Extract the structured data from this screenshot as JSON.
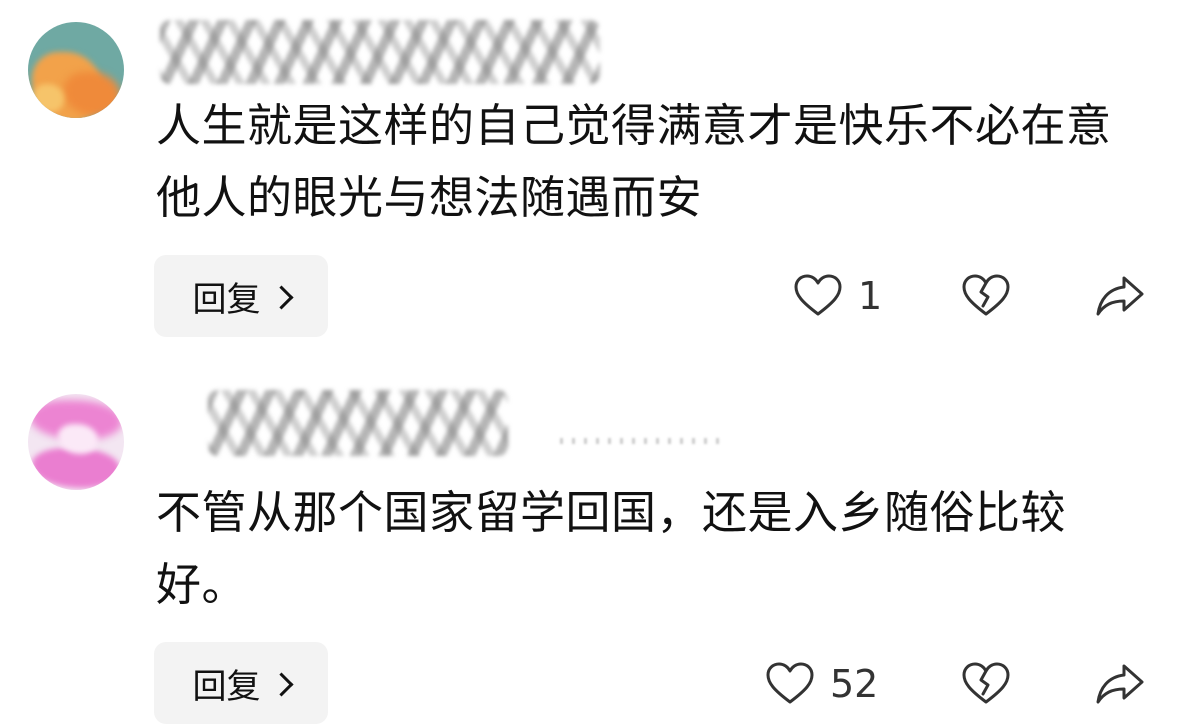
{
  "comments": [
    {
      "text": "人生就是这样的自己觉得满意才是快乐不必在意他人的眼光与想法随遇而安",
      "reply_label": "回复",
      "like_count": "1"
    },
    {
      "text": "不管从那个国家留学回国，还是入乡随俗比较好。",
      "reply_label": "回复",
      "like_count": "52"
    }
  ],
  "icons": {
    "like": "heart-outline-icon",
    "dislike": "broken-heart-icon",
    "share": "share-arrow-icon",
    "reply_chevron": "chevron-right-icon"
  },
  "colors": {
    "reply_button_bg": "#f3f3f3",
    "text": "#111111",
    "icon_stroke": "#333333"
  }
}
